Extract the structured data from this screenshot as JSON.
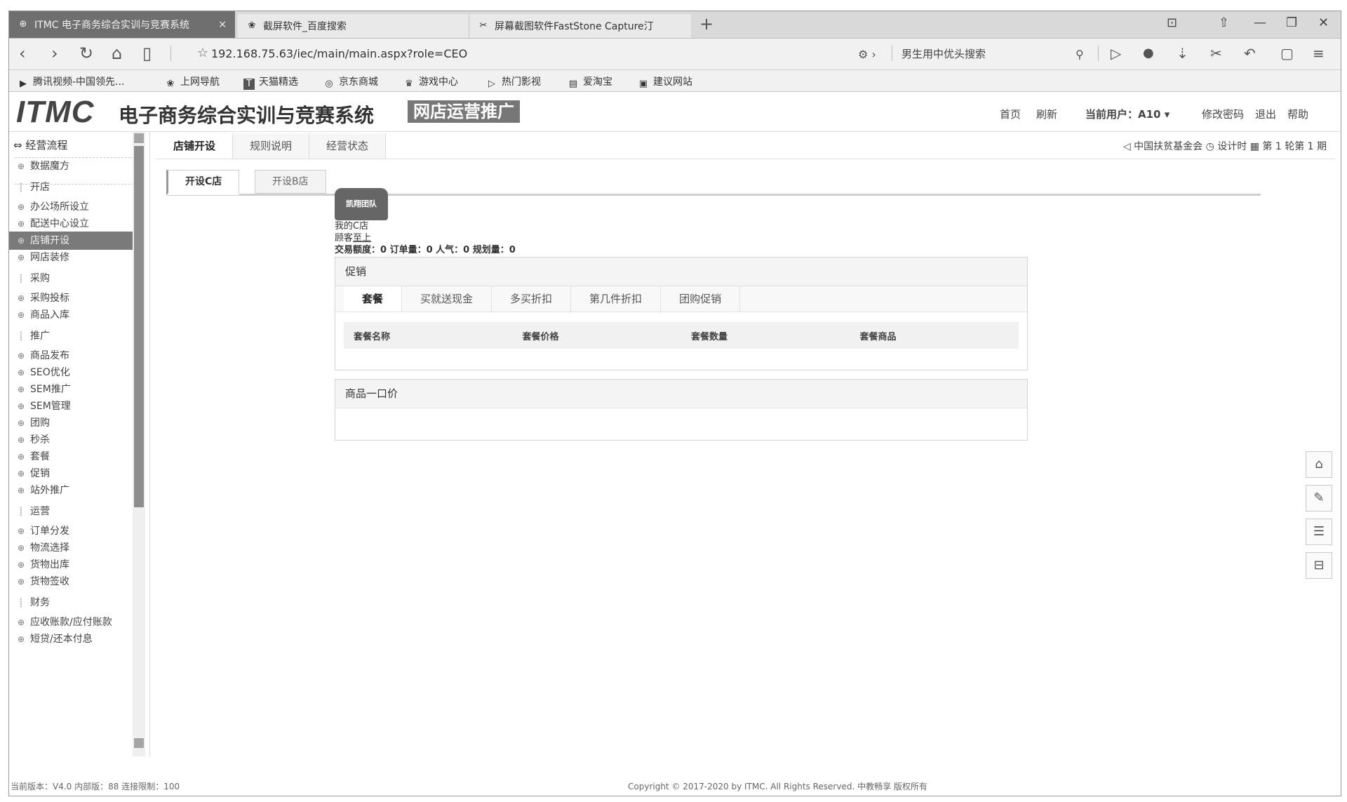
{
  "browser": {
    "tabs": [
      {
        "icon": "globe-icon",
        "label": "ITMC 电子商务综合实训与竞赛系统",
        "close": "×"
      },
      {
        "icon": "paw-icon",
        "label": "截屏软件_百度搜索"
      },
      {
        "icon": "scissors-icon",
        "label": "屏幕截图软件FastStone Capture汀"
      }
    ],
    "new_tab": "+",
    "window_controls": [
      "⊡",
      "⇧",
      "—",
      "❐",
      "✕"
    ],
    "nav": {
      "back": "‹",
      "forward": "›",
      "reload": "↻",
      "home": "⌂",
      "reader": "▯",
      "star": "☆"
    },
    "url": "192.168.75.63/iec/main/main.aspx?role=CEO",
    "search_text": "男生用中优头搜索",
    "toolbar_icons": [
      "▷",
      "●",
      "⇣",
      "✂",
      "↶",
      "▢",
      "≡"
    ]
  },
  "bookmarks": [
    {
      "icon": "▶",
      "label": "腾讯视频-中国领先..."
    },
    {
      "icon": "❀",
      "label": "上网导航"
    },
    {
      "icon": "T",
      "label": "天猫精选"
    },
    {
      "icon": "◎",
      "label": "京东商城"
    },
    {
      "icon": "♛",
      "label": "游戏中心"
    },
    {
      "icon": "▷",
      "label": "热门影视"
    },
    {
      "icon": "▤",
      "label": "爱淘宝"
    },
    {
      "icon": "▣",
      "label": "建议网站"
    }
  ],
  "app": {
    "logo": "ITMC",
    "title": "电子商务综合实训与竞赛系统",
    "badge": "网店运营推广",
    "links": [
      "首页",
      "刷新"
    ],
    "current_user": "当前用户：A10 ▾",
    "links2": [
      "修改密码",
      "退出",
      "帮助"
    ]
  },
  "sidebar": {
    "header": "经营流程",
    "items": [
      {
        "pre": "⊕",
        "label": "数据魔方",
        "type": "item"
      },
      {
        "pre": "┊",
        "label": "开店",
        "type": "group"
      },
      {
        "pre": "⊕",
        "label": "办公场所设立",
        "type": "item"
      },
      {
        "pre": "⊕",
        "label": "配送中心设立",
        "type": "item"
      },
      {
        "pre": "⊕",
        "label": "店铺开设",
        "type": "selected"
      },
      {
        "pre": "⊕",
        "label": "网店装修",
        "type": "item"
      },
      {
        "pre": "┊",
        "label": "采购",
        "type": "group"
      },
      {
        "pre": "⊕",
        "label": "采购投标",
        "type": "item"
      },
      {
        "pre": "⊕",
        "label": "商品入库",
        "type": "item"
      },
      {
        "pre": "┊",
        "label": "推广",
        "type": "group"
      },
      {
        "pre": "⊕",
        "label": "商品发布",
        "type": "item"
      },
      {
        "pre": "⊕",
        "label": "SEO优化",
        "type": "item"
      },
      {
        "pre": "⊕",
        "label": "SEM推广",
        "type": "item"
      },
      {
        "pre": "⊕",
        "label": "SEM管理",
        "type": "item"
      },
      {
        "pre": "⊕",
        "label": "团购",
        "type": "item"
      },
      {
        "pre": "⊕",
        "label": "秒杀",
        "type": "item"
      },
      {
        "pre": "⊕",
        "label": "套餐",
        "type": "item"
      },
      {
        "pre": "⊕",
        "label": "促销",
        "type": "item"
      },
      {
        "pre": "⊕",
        "label": "站外推广",
        "type": "item"
      },
      {
        "pre": "┊",
        "label": "运营",
        "type": "group"
      },
      {
        "pre": "⊕",
        "label": "订单分发",
        "type": "item"
      },
      {
        "pre": "⊕",
        "label": "物流选择",
        "type": "item"
      },
      {
        "pre": "⊕",
        "label": "货物出库",
        "type": "item"
      },
      {
        "pre": "⊕",
        "label": "货物签收",
        "type": "item"
      },
      {
        "pre": "┊",
        "label": "财务",
        "type": "group"
      },
      {
        "pre": "⊕",
        "label": "应收账款/应付账款",
        "type": "item"
      },
      {
        "pre": "⊕",
        "label": "短贷/还本付息",
        "type": "item"
      }
    ]
  },
  "main": {
    "top_tabs": [
      "店铺开设",
      "规则说明",
      "经营状态"
    ],
    "top_info": "◁ 中国扶贫基金会   ◷ 设计时   ▦ 第 1 轮第 1 期",
    "sub_tabs": [
      "开设C店",
      "开设B店"
    ],
    "shop": {
      "badge": "凯翔团队",
      "name": "我的C店",
      "grade_label": "顾客",
      "grade_value": "至上",
      "stats": "交易额度：0   订单量：0   人气：0   规划量：0"
    },
    "promo": {
      "title": "促销",
      "tabs": [
        "套餐",
        "买就送现金",
        "多买折扣",
        "第几件折扣",
        "团购促销"
      ],
      "columns": [
        "套餐名称",
        "套餐价格",
        "套餐数量",
        "套餐商品"
      ]
    },
    "price_panel": {
      "title": "商品一口价"
    }
  },
  "right_tools": [
    "⌂",
    "✎",
    "☰",
    "⊟"
  ],
  "footer": {
    "left": "当前版本：V4.0 内部版：88 连接限制：100",
    "center": "Copyright © 2017-2020 by ITMC. All Rights Reserved. 中教畅享 版权所有"
  }
}
